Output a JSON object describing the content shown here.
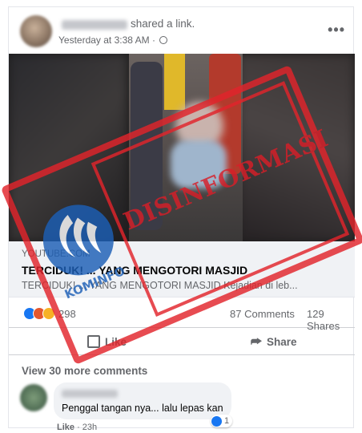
{
  "post": {
    "author_action": "shared a link.",
    "timestamp": "Yesterday at 3:38 AM · ",
    "privacy_icon": "globe-icon",
    "menu_icon": "more-icon",
    "menu_glyph": "•••"
  },
  "link_preview": {
    "domain": "YOUTUBE.COM",
    "title": "TERCIDUK! ... YANG MENGOTORI MASJID",
    "description": "TERCIDUK! ... YANG MENGOTORI MASJID Kejadian di leb..."
  },
  "reactions": {
    "count": "298",
    "comments": "87 Comments",
    "shares": "129 Shares",
    "icons": [
      "like-reaction-icon",
      "angry-reaction-icon",
      "wow-reaction-icon"
    ]
  },
  "actions": {
    "like_label": "Like",
    "share_label": "Share",
    "share_glyph": "⮫"
  },
  "comments": {
    "view_more": "View 30 more comments",
    "items": [
      {
        "text": "Penggal tangan nya... lalu lepas kan",
        "like_label": "Like",
        "time": " · 23h",
        "reaction_count": "1"
      }
    ]
  },
  "stamp": {
    "label": "DISINFORMASI",
    "logo_text": "KOMINFO",
    "color": "#e2242b",
    "logo_color": "#1c5fb6"
  },
  "colors": {
    "secondary_text": "#65676b",
    "primary_text": "#050505",
    "facebook_blue": "#1877f2"
  }
}
